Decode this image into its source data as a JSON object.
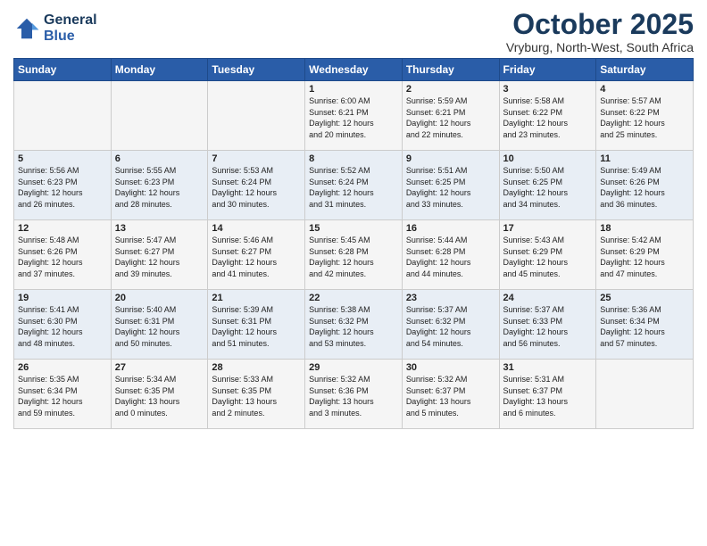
{
  "header": {
    "logo_line1": "General",
    "logo_line2": "Blue",
    "title": "October 2025",
    "subtitle": "Vryburg, North-West, South Africa"
  },
  "days_of_week": [
    "Sunday",
    "Monday",
    "Tuesday",
    "Wednesday",
    "Thursday",
    "Friday",
    "Saturday"
  ],
  "weeks": [
    [
      {
        "day": "",
        "info": ""
      },
      {
        "day": "",
        "info": ""
      },
      {
        "day": "",
        "info": ""
      },
      {
        "day": "1",
        "info": "Sunrise: 6:00 AM\nSunset: 6:21 PM\nDaylight: 12 hours\nand 20 minutes."
      },
      {
        "day": "2",
        "info": "Sunrise: 5:59 AM\nSunset: 6:21 PM\nDaylight: 12 hours\nand 22 minutes."
      },
      {
        "day": "3",
        "info": "Sunrise: 5:58 AM\nSunset: 6:22 PM\nDaylight: 12 hours\nand 23 minutes."
      },
      {
        "day": "4",
        "info": "Sunrise: 5:57 AM\nSunset: 6:22 PM\nDaylight: 12 hours\nand 25 minutes."
      }
    ],
    [
      {
        "day": "5",
        "info": "Sunrise: 5:56 AM\nSunset: 6:23 PM\nDaylight: 12 hours\nand 26 minutes."
      },
      {
        "day": "6",
        "info": "Sunrise: 5:55 AM\nSunset: 6:23 PM\nDaylight: 12 hours\nand 28 minutes."
      },
      {
        "day": "7",
        "info": "Sunrise: 5:53 AM\nSunset: 6:24 PM\nDaylight: 12 hours\nand 30 minutes."
      },
      {
        "day": "8",
        "info": "Sunrise: 5:52 AM\nSunset: 6:24 PM\nDaylight: 12 hours\nand 31 minutes."
      },
      {
        "day": "9",
        "info": "Sunrise: 5:51 AM\nSunset: 6:25 PM\nDaylight: 12 hours\nand 33 minutes."
      },
      {
        "day": "10",
        "info": "Sunrise: 5:50 AM\nSunset: 6:25 PM\nDaylight: 12 hours\nand 34 minutes."
      },
      {
        "day": "11",
        "info": "Sunrise: 5:49 AM\nSunset: 6:26 PM\nDaylight: 12 hours\nand 36 minutes."
      }
    ],
    [
      {
        "day": "12",
        "info": "Sunrise: 5:48 AM\nSunset: 6:26 PM\nDaylight: 12 hours\nand 37 minutes."
      },
      {
        "day": "13",
        "info": "Sunrise: 5:47 AM\nSunset: 6:27 PM\nDaylight: 12 hours\nand 39 minutes."
      },
      {
        "day": "14",
        "info": "Sunrise: 5:46 AM\nSunset: 6:27 PM\nDaylight: 12 hours\nand 41 minutes."
      },
      {
        "day": "15",
        "info": "Sunrise: 5:45 AM\nSunset: 6:28 PM\nDaylight: 12 hours\nand 42 minutes."
      },
      {
        "day": "16",
        "info": "Sunrise: 5:44 AM\nSunset: 6:28 PM\nDaylight: 12 hours\nand 44 minutes."
      },
      {
        "day": "17",
        "info": "Sunrise: 5:43 AM\nSunset: 6:29 PM\nDaylight: 12 hours\nand 45 minutes."
      },
      {
        "day": "18",
        "info": "Sunrise: 5:42 AM\nSunset: 6:29 PM\nDaylight: 12 hours\nand 47 minutes."
      }
    ],
    [
      {
        "day": "19",
        "info": "Sunrise: 5:41 AM\nSunset: 6:30 PM\nDaylight: 12 hours\nand 48 minutes."
      },
      {
        "day": "20",
        "info": "Sunrise: 5:40 AM\nSunset: 6:31 PM\nDaylight: 12 hours\nand 50 minutes."
      },
      {
        "day": "21",
        "info": "Sunrise: 5:39 AM\nSunset: 6:31 PM\nDaylight: 12 hours\nand 51 minutes."
      },
      {
        "day": "22",
        "info": "Sunrise: 5:38 AM\nSunset: 6:32 PM\nDaylight: 12 hours\nand 53 minutes."
      },
      {
        "day": "23",
        "info": "Sunrise: 5:37 AM\nSunset: 6:32 PM\nDaylight: 12 hours\nand 54 minutes."
      },
      {
        "day": "24",
        "info": "Sunrise: 5:37 AM\nSunset: 6:33 PM\nDaylight: 12 hours\nand 56 minutes."
      },
      {
        "day": "25",
        "info": "Sunrise: 5:36 AM\nSunset: 6:34 PM\nDaylight: 12 hours\nand 57 minutes."
      }
    ],
    [
      {
        "day": "26",
        "info": "Sunrise: 5:35 AM\nSunset: 6:34 PM\nDaylight: 12 hours\nand 59 minutes."
      },
      {
        "day": "27",
        "info": "Sunrise: 5:34 AM\nSunset: 6:35 PM\nDaylight: 13 hours\nand 0 minutes."
      },
      {
        "day": "28",
        "info": "Sunrise: 5:33 AM\nSunset: 6:35 PM\nDaylight: 13 hours\nand 2 minutes."
      },
      {
        "day": "29",
        "info": "Sunrise: 5:32 AM\nSunset: 6:36 PM\nDaylight: 13 hours\nand 3 minutes."
      },
      {
        "day": "30",
        "info": "Sunrise: 5:32 AM\nSunset: 6:37 PM\nDaylight: 13 hours\nand 5 minutes."
      },
      {
        "day": "31",
        "info": "Sunrise: 5:31 AM\nSunset: 6:37 PM\nDaylight: 13 hours\nand 6 minutes."
      },
      {
        "day": "",
        "info": ""
      }
    ]
  ]
}
